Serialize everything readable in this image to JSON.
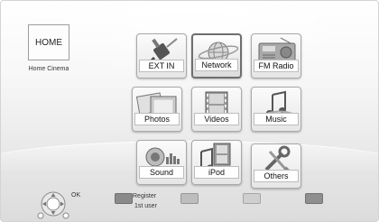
{
  "home": {
    "title": "HOME",
    "subtitle": "Home Cinema"
  },
  "menu": {
    "items": [
      {
        "label": "EXT IN",
        "icon": "ext-in-plug-icon"
      },
      {
        "label": "Network",
        "icon": "network-globe-icon",
        "selected": true
      },
      {
        "label": "FM Radio",
        "icon": "radio-icon"
      },
      {
        "label": "Photos",
        "icon": "photos-icon"
      },
      {
        "label": "Videos",
        "icon": "film-strip-icon"
      },
      {
        "label": "Music",
        "icon": "music-note-icon"
      },
      {
        "label": "Sound",
        "icon": "speaker-sound-icon"
      },
      {
        "label": "iPod",
        "icon": "ipod-icon"
      },
      {
        "label": "Others",
        "icon": "wrench-tools-icon"
      }
    ]
  },
  "footer": {
    "ok_label": "OK",
    "register_line1": "Register",
    "register_line2": "1st user",
    "color_keys": {
      "red": "#8a8a8a",
      "green": "#bdbdbd",
      "yellow": "#cfcfcf",
      "blue": "#8f8f8f"
    }
  }
}
